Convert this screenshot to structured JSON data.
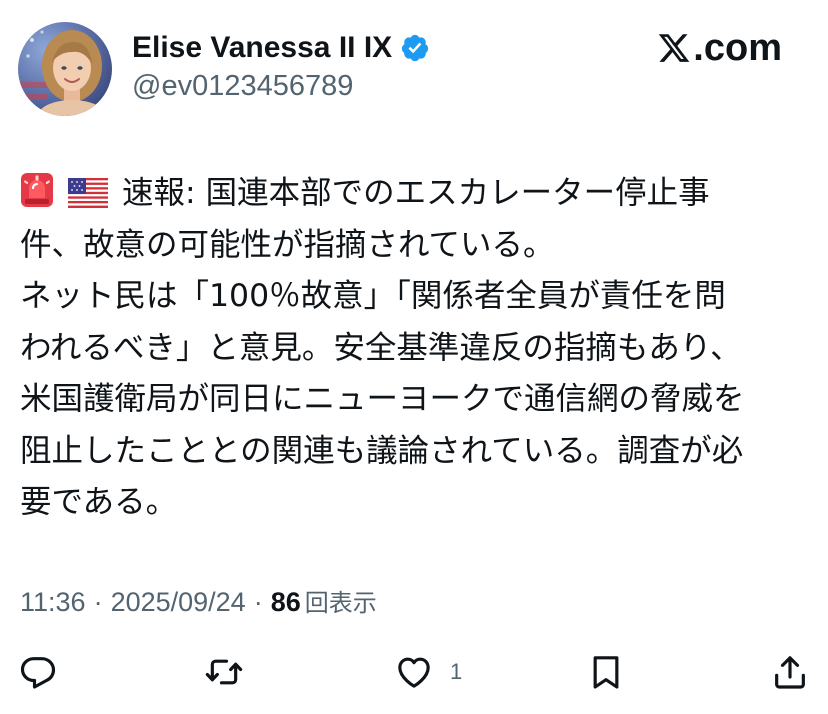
{
  "author": {
    "display_name": "Elise Vanessa II IX",
    "handle": "@ev0123456789",
    "verified": true,
    "verified_color": "#1d9bf0"
  },
  "brand": {
    "logo": "x-logo-icon",
    "suffix": ".com"
  },
  "tweet": {
    "emojis": [
      "siren-emoji",
      "us-flag-emoji"
    ],
    "lines": [
      "速報: 国連本部でのエスカレーター停止事",
      "件、故意の可能性が指摘されている。",
      "ネット民は「100％故意」「関係者全員が責任を問",
      "われるべき」と意見。安全基準違反の指摘もあり、",
      "米国護衛局が同日にニューヨークで通信網の脅威を",
      "阻止したこととの関連も議論されている。調査が必",
      "要である。"
    ]
  },
  "meta": {
    "time": "11:36",
    "separator": "·",
    "date": "2025/09/24",
    "views_count": "86",
    "views_label": "回表示"
  },
  "actions": {
    "reply_icon": "reply-icon",
    "retweet_icon": "retweet-icon",
    "like_icon": "heart-icon",
    "like_count": "1",
    "bookmark_icon": "bookmark-icon",
    "share_icon": "share-icon"
  },
  "colors": {
    "text": "#0f1419",
    "secondary": "#536471"
  }
}
